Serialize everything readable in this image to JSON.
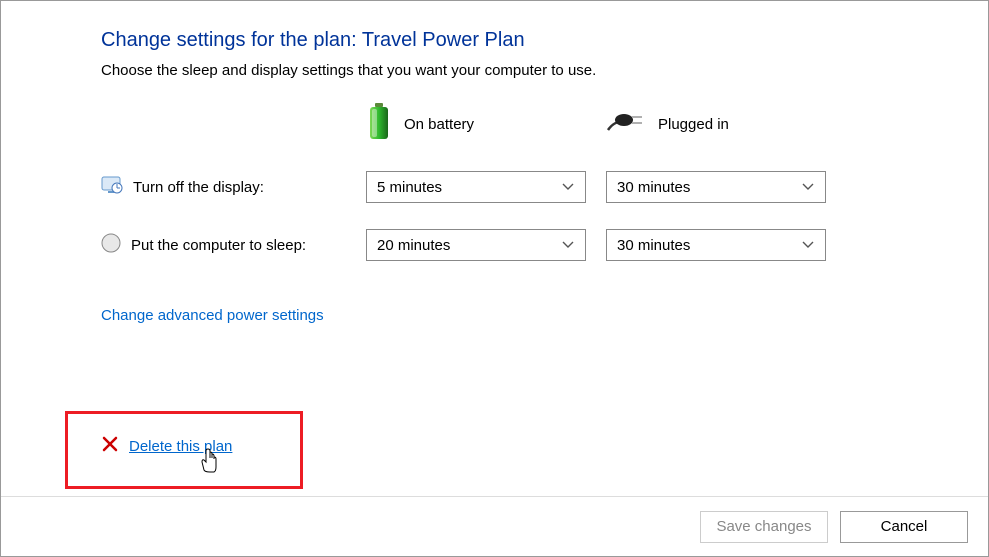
{
  "page_title": "Change settings for the plan: Travel Power Plan",
  "subtitle": "Choose the sleep and display settings that you want your computer to use.",
  "columns": {
    "battery": "On battery",
    "plugged": "Plugged in"
  },
  "rows": {
    "display": {
      "label": "Turn off the display:",
      "battery_value": "5 minutes",
      "plugged_value": "30 minutes"
    },
    "sleep": {
      "label": "Put the computer to sleep:",
      "battery_value": "20 minutes",
      "plugged_value": "30 minutes"
    }
  },
  "links": {
    "advanced": "Change advanced power settings",
    "delete": "Delete this plan"
  },
  "buttons": {
    "save": "Save changes",
    "cancel": "Cancel"
  }
}
